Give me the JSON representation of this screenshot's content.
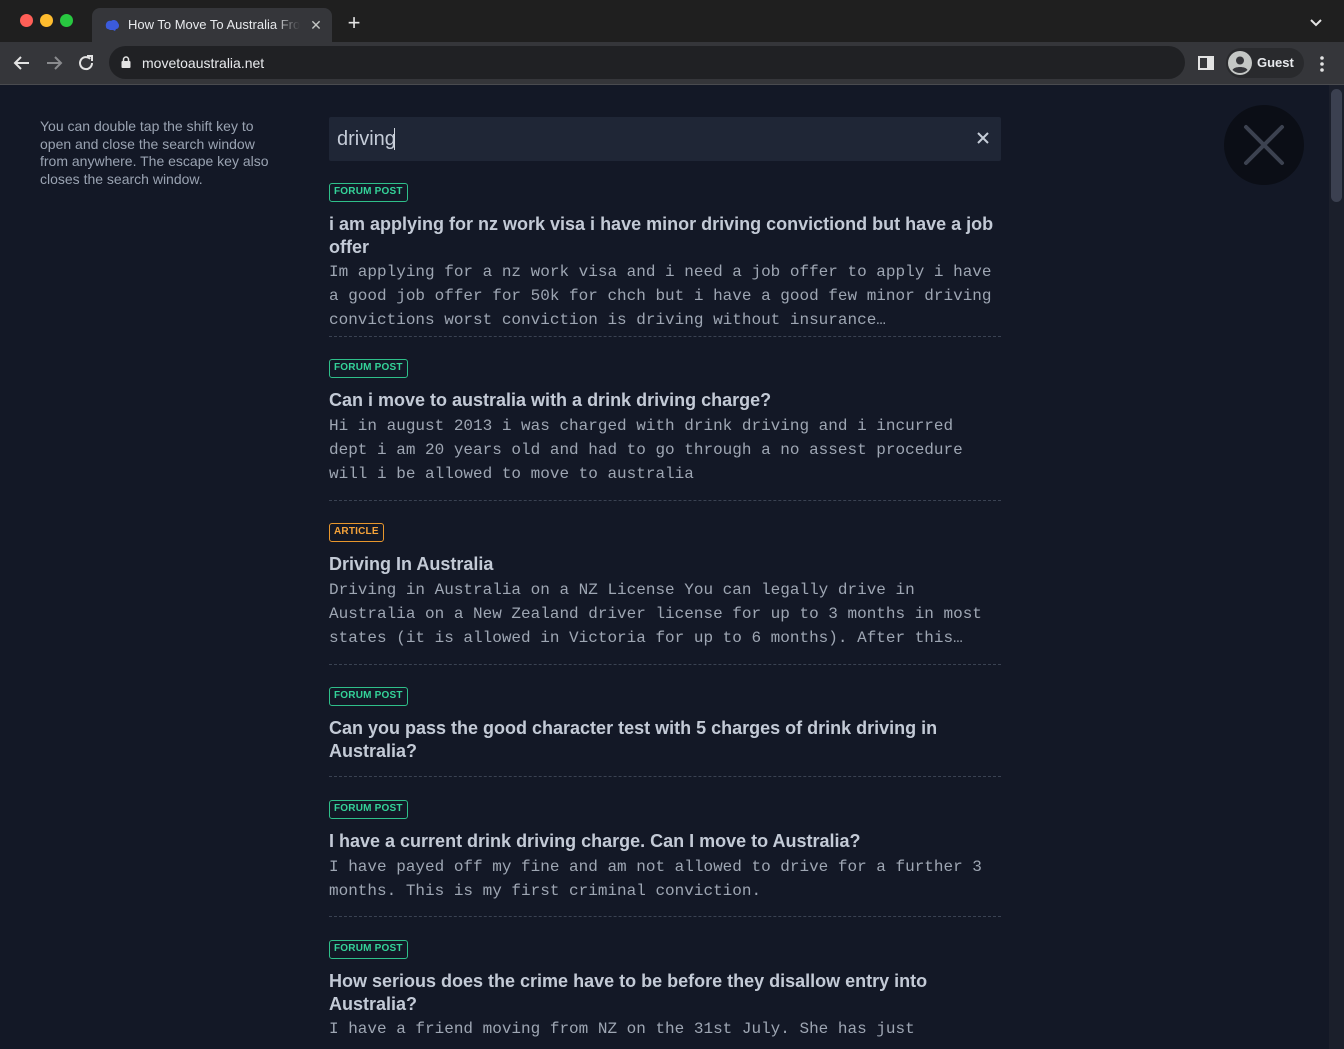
{
  "browser": {
    "tab_title": "How To Move To Australia From New Zealand",
    "url": "movetoaustralia.net",
    "profile_label": "Guest"
  },
  "hint": {
    "text": "You can double tap the shift key to open and close the search window from anywhere. The escape key also closes the search window."
  },
  "search": {
    "value": "driving"
  },
  "results": [
    {
      "badge": "FORUM POST",
      "type": "forum",
      "title": "i am applying for nz work visa i have minor driving convictiond but have a job offer",
      "body": "Im applying for a nz work visa and i need a job offer to apply i have a good job offer for 50k for chch but i have a good few minor driving convictions worst conviction is driving without insurance…"
    },
    {
      "badge": "FORUM POST",
      "type": "forum",
      "title": "Can i move to australia with a drink driving charge?",
      "body": "Hi in august 2013 i was charged with drink driving and i incurred dept i am 20 years old and had to go through a no assest procedure will i be allowed to move to australia"
    },
    {
      "badge": "ARTICLE",
      "type": "article",
      "title": "Driving In Australia",
      "body": "Driving in Australia on a NZ License You can legally drive in Australia on a New Zealand driver license for up to 3 months in most states (it is allowed in Victoria for up to 6 months). After this…"
    },
    {
      "badge": "FORUM POST",
      "type": "forum",
      "title": "Can you pass the good character test with 5 charges of drink driving in Australia?",
      "body": ""
    },
    {
      "badge": "FORUM POST",
      "type": "forum",
      "title": "I have a current drink driving charge. Can I move to Australia?",
      "body": "I have payed off my fine and am not allowed to drive for a further 3 months. This is my first criminal conviction."
    },
    {
      "badge": "FORUM POST",
      "type": "forum",
      "title": "How serious does the crime have to be before they disallow entry into Australia?",
      "body": "I have a friend moving from NZ on the 31st July. She has just"
    }
  ],
  "colors": {
    "forum_badge": "#34d399",
    "article_badge": "#f5a33a",
    "page_bg": "#131826"
  }
}
